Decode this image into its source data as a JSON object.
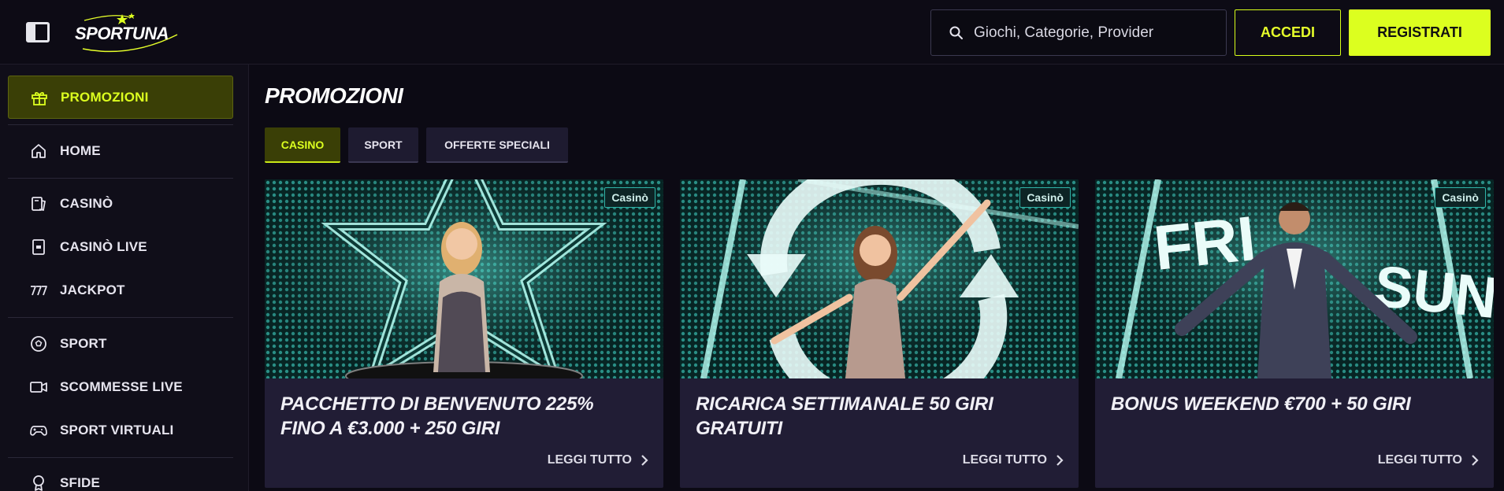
{
  "header": {
    "logo_text": "SPORTUNA",
    "search_placeholder": "Giochi, Categorie, Provider",
    "login_label": "ACCEDI",
    "register_label": "REGISTRATI"
  },
  "sidebar": {
    "items": [
      {
        "label": "PROMOZIONI",
        "icon": "gift-icon"
      },
      {
        "label": "HOME",
        "icon": "home-icon"
      },
      {
        "label": "CASINÒ",
        "icon": "cards-icon"
      },
      {
        "label": "CASINÒ LIVE",
        "icon": "live-card-icon"
      },
      {
        "label": "JACKPOT",
        "icon": "jackpot-777-icon"
      },
      {
        "label": "SPORT",
        "icon": "soccer-ball-icon"
      },
      {
        "label": "SCOMMESSE LIVE",
        "icon": "video-camera-icon"
      },
      {
        "label": "SPORT VIRTUALI",
        "icon": "gamepad-icon"
      },
      {
        "label": "SFIDE",
        "icon": "trophy-icon"
      }
    ]
  },
  "main": {
    "title": "PROMOZIONI",
    "tabs": [
      "CASINO",
      "SPORT",
      "OFFERTE SPECIALI"
    ],
    "cards": [
      {
        "badge": "Casinò",
        "title": "PACCHETTO DI BENVENUTO 225% FINO A €3.000 + 250 GIRI",
        "link": "LEGGI TUTTO"
      },
      {
        "badge": "Casinò",
        "title": "RICARICA SETTIMANALE 50 GIRI GRATUITI",
        "link": "LEGGI TUTTO"
      },
      {
        "badge": "Casinò",
        "title": "BONUS WEEKEND €700 + 50 GIRI",
        "link": "LEGGI TUTTO"
      }
    ],
    "image_texts": {
      "fri": "FRI",
      "sun": "SUN"
    }
  },
  "colors": {
    "accent": "#dcff1f",
    "background": "#0c0a14",
    "card": "#211d35",
    "teal": "#2fb3a7"
  }
}
